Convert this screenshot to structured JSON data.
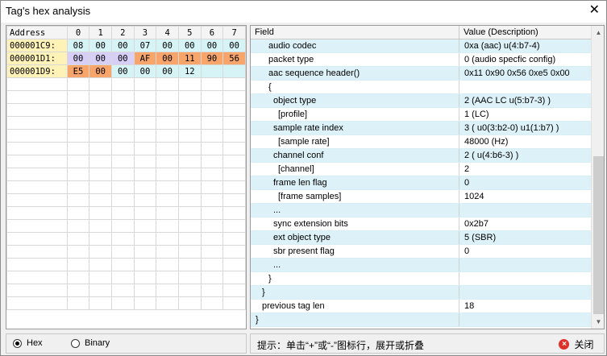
{
  "window": {
    "title": "Tag's hex analysis",
    "close_glyph": "✕"
  },
  "hex": {
    "header": [
      "Address",
      "0",
      "1",
      "2",
      "3",
      "4",
      "5",
      "6",
      "7"
    ],
    "rows": [
      {
        "address": "000001C9:",
        "address_color": "yellow",
        "cells": [
          {
            "v": "08",
            "c": "cyan"
          },
          {
            "v": "00",
            "c": "cyan"
          },
          {
            "v": "00",
            "c": "cyan"
          },
          {
            "v": "07",
            "c": "cyan"
          },
          {
            "v": "00",
            "c": "cyan"
          },
          {
            "v": "00",
            "c": "cyan"
          },
          {
            "v": "00",
            "c": "cyan"
          },
          {
            "v": "00",
            "c": "cyan"
          }
        ]
      },
      {
        "address": "000001D1:",
        "address_color": "yellow",
        "cells": [
          {
            "v": "00",
            "c": "purple"
          },
          {
            "v": "00",
            "c": "purple"
          },
          {
            "v": "00",
            "c": "purple"
          },
          {
            "v": "AF",
            "c": "orange"
          },
          {
            "v": "00",
            "c": "orange"
          },
          {
            "v": "11",
            "c": "orange"
          },
          {
            "v": "90",
            "c": "orange"
          },
          {
            "v": "56",
            "c": "orange"
          }
        ]
      },
      {
        "address": "000001D9:",
        "address_color": "yellow",
        "cells": [
          {
            "v": "E5",
            "c": "orange"
          },
          {
            "v": "00",
            "c": "orange"
          },
          {
            "v": "00",
            "c": "cyan"
          },
          {
            "v": "00",
            "c": "cyan"
          },
          {
            "v": "00",
            "c": "cyan"
          },
          {
            "v": "12",
            "c": "cyan"
          },
          {
            "v": "",
            "c": "cyan"
          },
          {
            "v": "",
            "c": "cyan"
          }
        ]
      }
    ],
    "blank_rows": 18
  },
  "fields": {
    "header_field": "Field",
    "header_value": "Value (Description)",
    "rows": [
      {
        "field": "audio codec",
        "indent": 22,
        "value": "0xa (aac)  u(4:b7-4)"
      },
      {
        "field": "packet type",
        "indent": 22,
        "value": "0 (audio specfic config)"
      },
      {
        "field": "aac sequence header()",
        "indent": 22,
        "value": "0x11 0x90 0x56 0xe5 0x00"
      },
      {
        "field": "{",
        "indent": 22,
        "value": ""
      },
      {
        "field": "object type",
        "indent": 28,
        "value": "2 (AAC LC  u(5:b7-3) )"
      },
      {
        "field": "[profile]",
        "indent": 34,
        "value": "1 (LC)"
      },
      {
        "field": "sample rate index",
        "indent": 28,
        "value": "3 ( u0(3:b2-0) u1(1:b7) )"
      },
      {
        "field": "[sample rate]",
        "indent": 34,
        "value": "48000 (Hz)"
      },
      {
        "field": "channel conf",
        "indent": 28,
        "value": "2 ( u(4:b6-3) )"
      },
      {
        "field": "[channel]",
        "indent": 34,
        "value": "2"
      },
      {
        "field": "frame len flag",
        "indent": 28,
        "value": "0"
      },
      {
        "field": "[frame samples]",
        "indent": 34,
        "value": "1024"
      },
      {
        "field": "...",
        "indent": 28,
        "value": ""
      },
      {
        "field": "sync extension bits",
        "indent": 28,
        "value": "0x2b7"
      },
      {
        "field": "ext object type",
        "indent": 28,
        "value": "5 (SBR)"
      },
      {
        "field": "sbr present flag",
        "indent": 28,
        "value": "0"
      },
      {
        "field": "...",
        "indent": 28,
        "value": ""
      },
      {
        "field": "}",
        "indent": 22,
        "value": ""
      },
      {
        "field": "}",
        "indent": 14,
        "value": ""
      },
      {
        "field": "previous tag len",
        "indent": 14,
        "value": "18"
      },
      {
        "field": "}",
        "indent": 6,
        "value": ""
      }
    ],
    "scroll_up_glyph": "▲",
    "scroll_down_glyph": "▼"
  },
  "mode": {
    "hex_label": "Hex",
    "binary_label": "Binary",
    "selected": "hex"
  },
  "footer": {
    "hint": "提示：单击“+”或“-”图标行，展开或折叠",
    "close_label": "关闭",
    "close_icon_glyph": "×"
  }
}
